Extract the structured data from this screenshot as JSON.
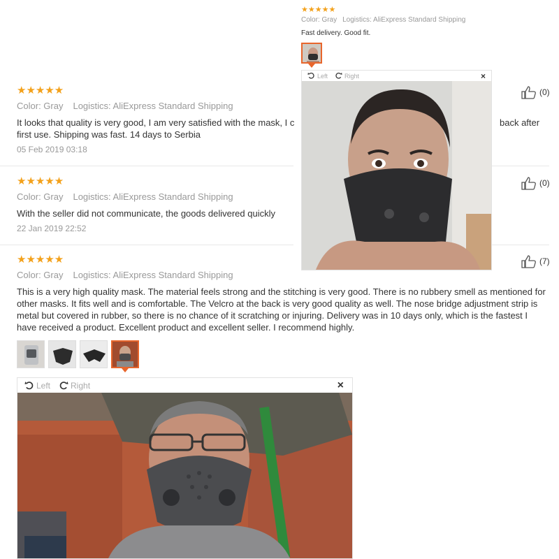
{
  "colors": {
    "star": "#f3a11b",
    "accent": "#e8662c",
    "muted": "#999999",
    "text": "#333333"
  },
  "top_review": {
    "stars": "★★★★★",
    "color_label": "Color: Gray",
    "logistics_label": "Logistics: AliExpress Standard Shipping",
    "text": "Fast delivery. Good fit."
  },
  "reviews": [
    {
      "stars": "★★★★★",
      "color_label": "Color: Gray",
      "logistics_label": "Logistics: AliExpress Standard Shipping",
      "text_left": "It looks that quality is very good, I am very satisfied with the mask, I c",
      "text_right": "back after",
      "text_line2": "first use. Shipping was fast. 14 days to Serbia",
      "date": "05 Feb 2019 03:18",
      "likes": "(0)"
    },
    {
      "stars": "★★★★★",
      "color_label": "Color: Gray",
      "logistics_label": "Logistics: AliExpress Standard Shipping",
      "text": "With the seller did not communicate, the goods delivered quickly",
      "date": "22 Jan 2019 22:52",
      "likes": "(0)"
    },
    {
      "stars": "★★★★★",
      "color_label": "Color: Gray",
      "logistics_label": "Logistics: AliExpress Standard Shipping",
      "text": "This is a very high quality mask. The material feels strong and the stitching is very good. There is no rubbery smell as mentioned for other masks. It fits well and is comfortable. The Velcro at the back is very good quality as well. The nose bridge adjustment strip is metal but covered in rubber, so there is no chance of it scratching or injuring. Delivery was in 10 days only, which is the fastest I have received a product. Excellent product and excellent seller. I recommend highly.",
      "likes": "(7)"
    }
  ],
  "viewer": {
    "rotate_left": "Left",
    "rotate_right": "Right",
    "close": "×"
  },
  "icons": {
    "rotate_left": "rotate-left-icon",
    "rotate_right": "rotate-right-icon",
    "close": "close-icon",
    "like": "thumbs-up-icon"
  }
}
